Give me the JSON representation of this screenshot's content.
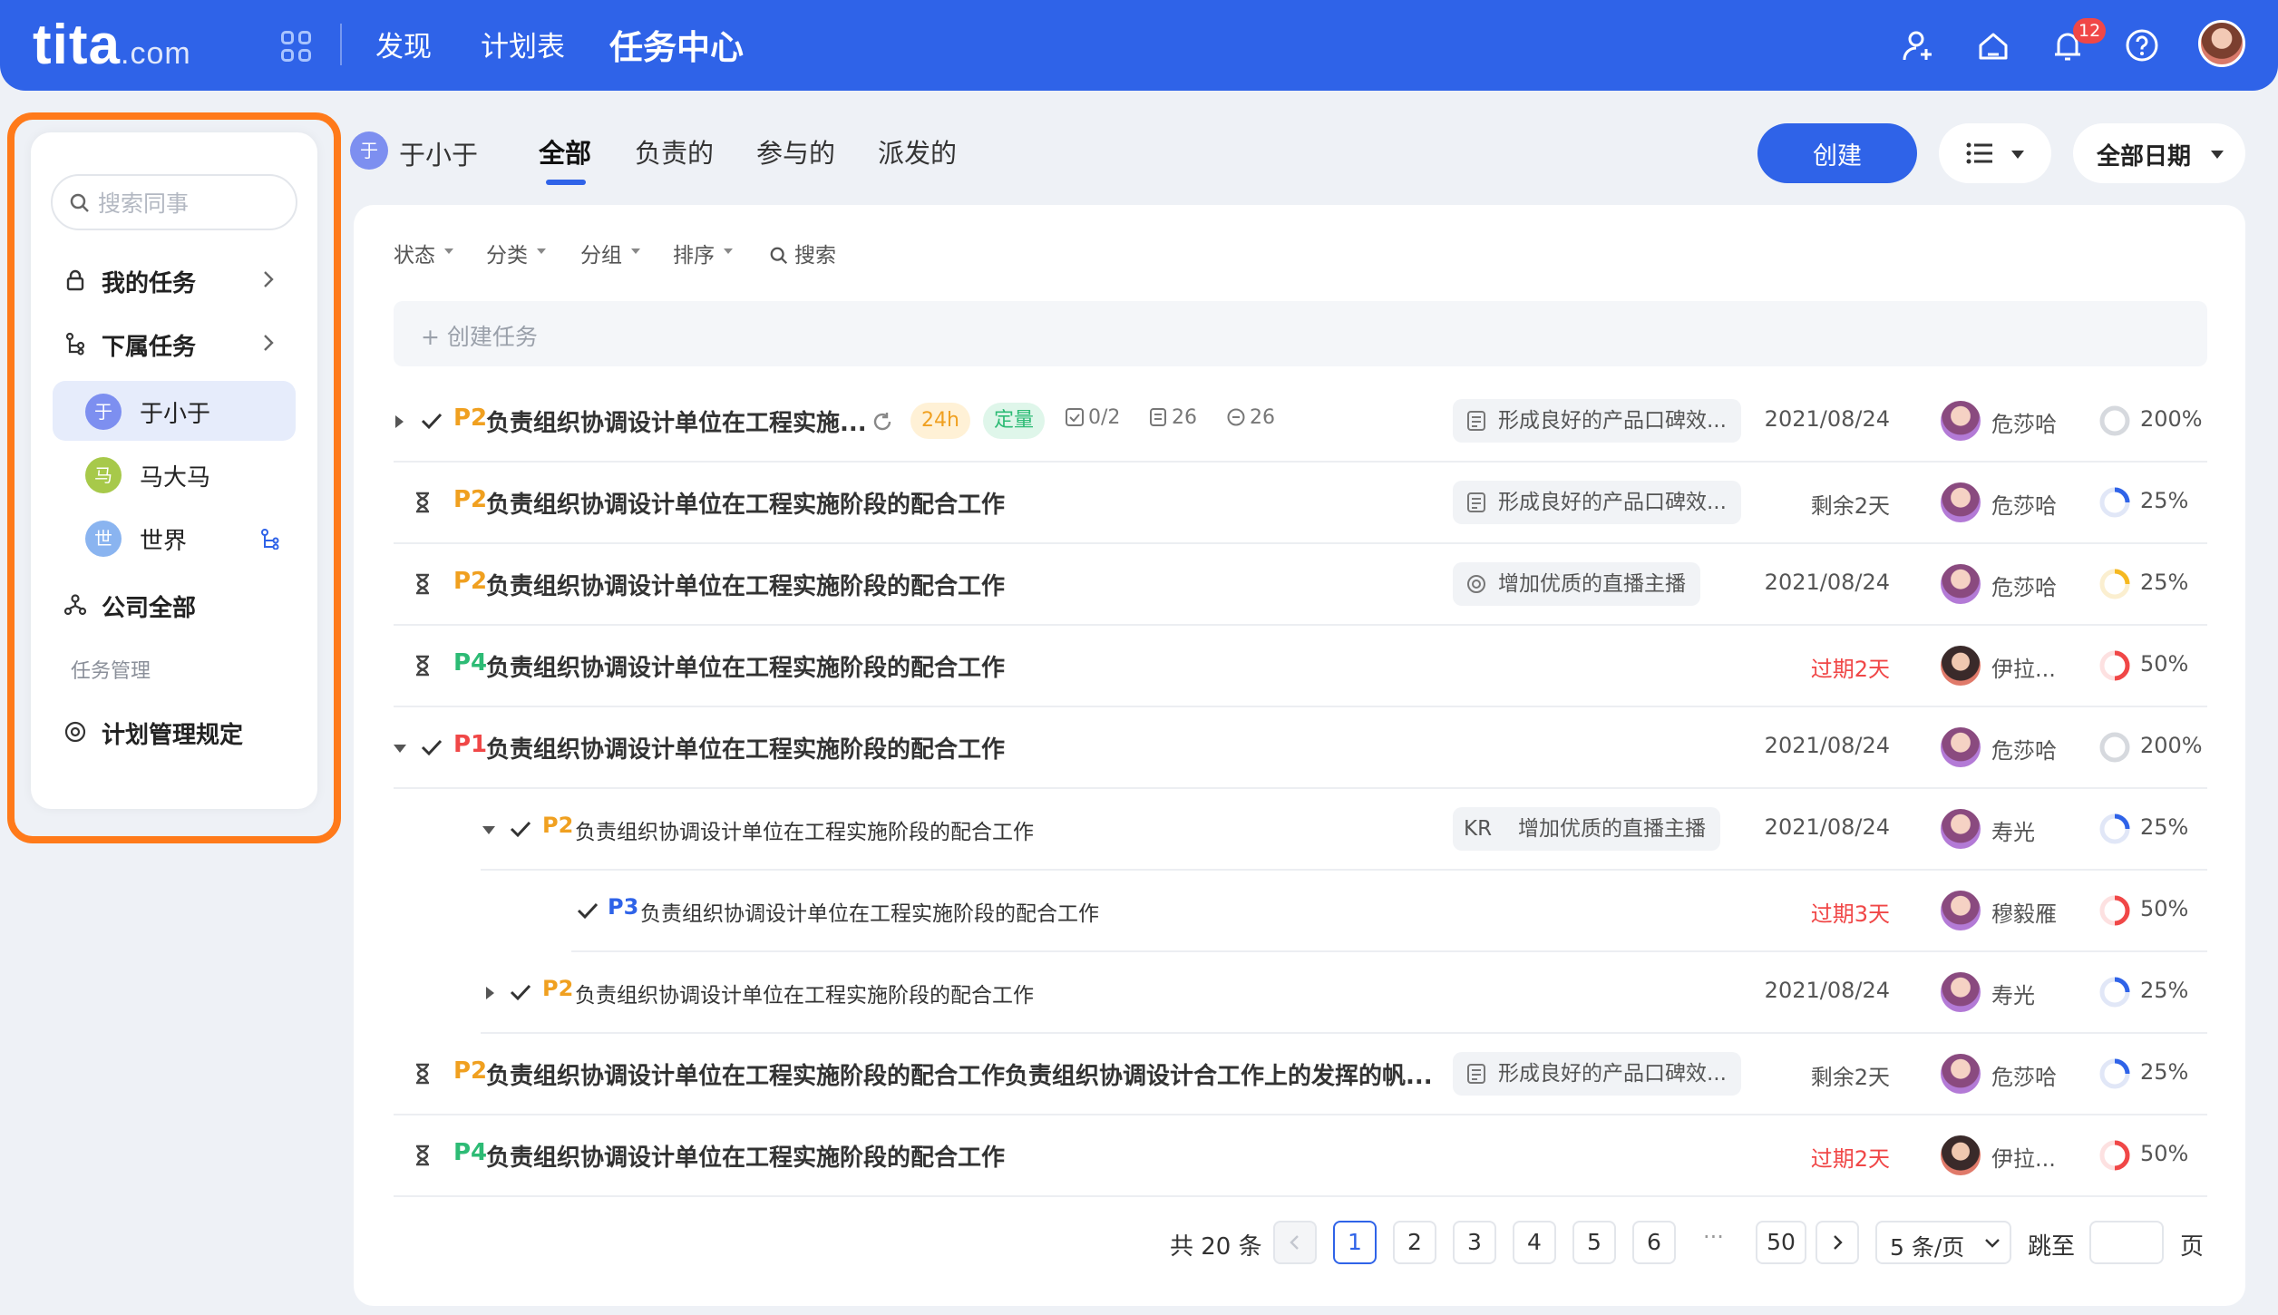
{
  "topbar": {
    "logo": "tita",
    "logo_suffix": ".com",
    "nav": [
      "发现",
      "计划表",
      "任务中心"
    ],
    "notification_count": "12"
  },
  "sidebar": {
    "search_placeholder": "搜索同事",
    "my_tasks": "我的任务",
    "sub_tasks": "下属任务",
    "members": [
      {
        "initial": "于",
        "name": "于小于",
        "color": "#7d8ff0"
      },
      {
        "initial": "马",
        "name": "马大马",
        "color": "#a7c94a"
      },
      {
        "initial": "世",
        "name": "世界",
        "color": "#8ab4f0"
      }
    ],
    "company_all": "公司全部",
    "section_label": "任务管理",
    "plan_rules": "计划管理规定"
  },
  "header": {
    "user_initial": "于",
    "user_name": "于小于",
    "tabs": [
      "全部",
      "负责的",
      "参与的",
      "派发的"
    ],
    "create_button": "创建",
    "date_filter": "全部日期"
  },
  "filters": [
    "状态",
    "分类",
    "分组",
    "排序",
    "搜索"
  ],
  "create_task_placeholder": "+ 创建任务",
  "accent": "#2f63e8",
  "tasks": [
    {
      "priority": "P2",
      "title": "负责组织协调设计单位在工程实施...",
      "tag_time": "24h",
      "tag_quant": "定量",
      "checklist": "0/2",
      "attachments": "26",
      "comments": "26",
      "goal": "形成良好的产品口碑效...",
      "due": "2021/08/24",
      "owner": "危莎哈",
      "progress": "200%"
    },
    {
      "priority": "P2",
      "title": "负责组织协调设计单位在工程实施阶段的配合工作",
      "goal": "形成良好的产品口碑效...",
      "due": "剩余2天",
      "owner": "危莎哈",
      "progress": "25%"
    },
    {
      "priority": "P2",
      "title": "负责组织协调设计单位在工程实施阶段的配合工作",
      "goal": "增加优质的直播主播",
      "due": "2021/08/24",
      "owner": "危莎哈",
      "progress": "25%"
    },
    {
      "priority": "P4",
      "title": "负责组织协调设计单位在工程实施阶段的配合工作",
      "due": "过期2天",
      "owner": "伊拉...",
      "progress": "50%"
    },
    {
      "priority": "P1",
      "title": "负责组织协调设计单位在工程实施阶段的配合工作",
      "due": "2021/08/24",
      "owner": "危莎哈",
      "progress": "200%"
    },
    {
      "priority": "P2",
      "title": "负责组织协调设计单位在工程实施阶段的配合工作",
      "goal_prefix": "KR",
      "goal": "增加优质的直播主播",
      "due": "2021/08/24",
      "owner": "寿光",
      "progress": "25%"
    },
    {
      "priority": "P3",
      "title": "负责组织协调设计单位在工程实施阶段的配合工作",
      "due": "过期3天",
      "owner": "穆毅雁",
      "progress": "50%"
    },
    {
      "priority": "P2",
      "title": "负责组织协调设计单位在工程实施阶段的配合工作",
      "due": "2021/08/24",
      "owner": "寿光",
      "progress": "25%"
    },
    {
      "priority": "P2",
      "title": "负责组织协调设计单位在工程实施阶段的配合工作负责组织协调设计合工作上的发挥的帆...",
      "goal": "形成良好的产品口碑效...",
      "due": "剩余2天",
      "owner": "危莎哈",
      "progress": "25%"
    },
    {
      "priority": "P4",
      "title": "负责组织协调设计单位在工程实施阶段的配合工作",
      "due": "过期2天",
      "owner": "伊拉...",
      "progress": "50%"
    }
  ],
  "pagination": {
    "total": "共 20 条",
    "pages": [
      "1",
      "2",
      "3",
      "4",
      "5",
      "6"
    ],
    "ellipsis": "···",
    "last": "50",
    "page_size": "5 条/页",
    "jump_label": "跳至",
    "page_unit": "页"
  }
}
